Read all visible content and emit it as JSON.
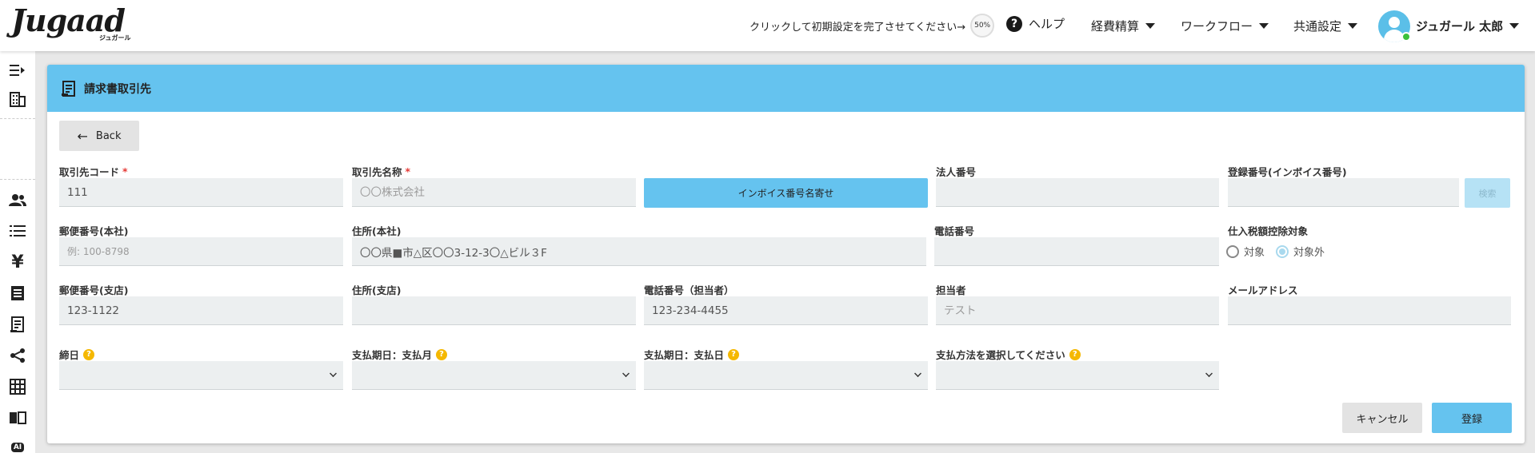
{
  "header": {
    "logo": "Jugaad",
    "logo_sub": "ジュガール",
    "setup_text": "クリックして初期設定を完了させてください→",
    "setup_progress": "50%",
    "help_label": "ヘルプ",
    "menus": [
      "経費精算",
      "ワークフロー",
      "共通設定"
    ],
    "user_name": "ジュガール 太郎"
  },
  "sidebar": {
    "icons": [
      "collapse-menu-icon",
      "building-icon",
      "users-icon",
      "list-icon",
      "yen-icon",
      "receipt-icon",
      "invoice-icon",
      "share-icon",
      "grid-icon",
      "book-icon",
      "ai-icon"
    ],
    "ai_label": "AI"
  },
  "page": {
    "title": "請求書取引先",
    "back_label": "Back"
  },
  "form": {
    "partner_code": {
      "label": "取引先コード",
      "required": "*",
      "value": "111"
    },
    "partner_name": {
      "label": "取引先名称",
      "required": "*",
      "placeholder": "〇〇株式会社"
    },
    "invoice_lookup_button": "インボイス番号名寄せ",
    "corporate_number": {
      "label": "法人番号",
      "value": ""
    },
    "registration_number": {
      "label": "登録番号(インボイス番号)",
      "value": ""
    },
    "search_button": "検索",
    "postal_hq": {
      "label": "郵便番号(本社)",
      "placeholder": "例: 100-8798"
    },
    "address_hq": {
      "label": "住所(本社)",
      "value": "〇〇県■市△区〇〇3-12-3〇△ビル３F"
    },
    "phone": {
      "label": "電話番号",
      "value": ""
    },
    "tax_deduction": {
      "label": "仕入税額控除対象",
      "options": [
        "対象",
        "対象外"
      ],
      "selected": "対象外"
    },
    "postal_branch": {
      "label": "郵便番号(支店)",
      "value": "123-1122"
    },
    "address_branch": {
      "label": "住所(支店)",
      "value": ""
    },
    "phone_contact": {
      "label": "電話番号（担当者）",
      "value": "123-234-4455"
    },
    "contact_person": {
      "label": "担当者",
      "placeholder": "テスト"
    },
    "email": {
      "label": "メールアドレス",
      "value": ""
    },
    "closing_day": {
      "label": "締日",
      "value": ""
    },
    "payment_month": {
      "label": "支払期日：支払月",
      "value": ""
    },
    "payment_day": {
      "label": "支払期日：支払日",
      "value": ""
    },
    "payment_method": {
      "label": "支払方法を選択してください",
      "value": ""
    }
  },
  "actions": {
    "cancel_label": "キャンセル",
    "submit_label": "登録"
  },
  "colors": {
    "accent": "#65c3ef",
    "required": "#e53935",
    "help_badge": "#f5b800"
  }
}
